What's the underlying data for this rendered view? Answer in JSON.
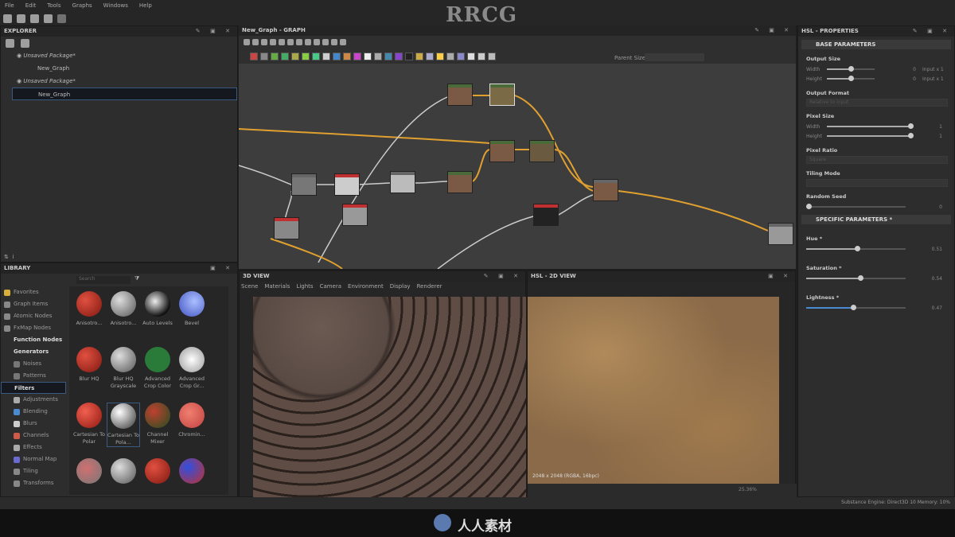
{
  "brand_watermark": "RRCG",
  "footer_logo": "人人素材",
  "menu": [
    "File",
    "Edit",
    "Tools",
    "Graphs",
    "Windows",
    "Help"
  ],
  "explorer": {
    "title": "EXPLORER",
    "items": [
      {
        "label": "Unsaved Package*",
        "child": "New_Graph"
      },
      {
        "label": "Unsaved Package*",
        "child": "New_Graph"
      }
    ]
  },
  "graph": {
    "title": "New_Graph - GRAPH",
    "parent_size_label": "Parent Size:"
  },
  "library": {
    "title": "LIBRARY",
    "search_placeholder": "Search",
    "nav": [
      {
        "label": "Favorites",
        "c": "#d6b03a"
      },
      {
        "label": "Graph Items",
        "c": "#888"
      },
      {
        "label": "Atomic Nodes",
        "c": "#888"
      },
      {
        "label": "FxMap Nodes",
        "c": "#888"
      },
      {
        "label": "Function Nodes",
        "bold": true
      },
      {
        "label": "Generators",
        "bold": true
      },
      {
        "label": "Noises",
        "sub": true,
        "c": "#777"
      },
      {
        "label": "Patterns",
        "sub": true,
        "c": "#777"
      },
      {
        "label": "Filters",
        "bold": true,
        "sel": true
      },
      {
        "label": "Adjustments",
        "sub": true,
        "c": "#aaa"
      },
      {
        "label": "Blending",
        "sub": true,
        "c": "#4a8ad0"
      },
      {
        "label": "Blurs",
        "sub": true,
        "c": "#ccc"
      },
      {
        "label": "Channels",
        "sub": true,
        "c": "#d05a4a"
      },
      {
        "label": "Effects",
        "sub": true,
        "c": "#aaa"
      },
      {
        "label": "Normal Map",
        "sub": true,
        "c": "#6a6ad0"
      },
      {
        "label": "Tiling",
        "sub": true,
        "c": "#888"
      },
      {
        "label": "Transforms",
        "sub": true,
        "c": "#888"
      }
    ],
    "items": [
      {
        "label": "Anisotro...",
        "c": "radial-gradient(circle at 35% 35%,#e05040,#801810)"
      },
      {
        "label": "Anisotro...",
        "c": "radial-gradient(circle at 35% 35%,#ddd,#555)"
      },
      {
        "label": "Auto Levels",
        "c": "radial-gradient(circle at 40% 40%,#eee,#111 70%)"
      },
      {
        "label": "Bevel",
        "c": "radial-gradient(circle at 60% 40%,#aac0ff,#4050c0)"
      },
      {
        "label": "Blur HQ",
        "c": "radial-gradient(circle at 35% 35%,#e05040,#801810)"
      },
      {
        "label": "Blur HQ Grayscale",
        "c": "radial-gradient(circle at 35% 35%,#ddd,#555)"
      },
      {
        "label": "Advanced Crop Color",
        "c": "#2a7a3a"
      },
      {
        "label": "Advanced Crop Gr...",
        "c": "radial-gradient(circle,#fff,#999)"
      },
      {
        "label": "Cartesian To Polar",
        "c": "radial-gradient(circle at 35% 35%,#f06050,#901810)"
      },
      {
        "label": "Cartesian To Pola...",
        "c": "radial-gradient(circle at 35% 35%,#fff,#333)"
      },
      {
        "label": "Channel Mixer",
        "c": "radial-gradient(circle at 35% 35%,#c04030,#205020)"
      },
      {
        "label": "Chromin...",
        "c": "radial-gradient(circle at 40% 40%,#f08070,#c04040)"
      },
      {
        "label": "",
        "c": "radial-gradient(circle at 40% 40%,#d07070,#777)"
      },
      {
        "label": "",
        "c": "radial-gradient(circle at 35% 35%,#ddd,#555)"
      },
      {
        "label": "",
        "c": "radial-gradient(circle at 35% 35%,#e05040,#801810)"
      },
      {
        "label": "",
        "c": "radial-gradient(circle at 35% 35%,#3050e0,#c03030)"
      }
    ]
  },
  "view3d": {
    "title": "3D VIEW",
    "menu": [
      "Scene",
      "Materials",
      "Lights",
      "Camera",
      "Environment",
      "Display",
      "Renderer"
    ]
  },
  "view2d": {
    "title": "HSL - 2D VIEW",
    "info": "2048 x 2048 (RGBA, 16bpc)",
    "zoom": "25.36%"
  },
  "properties": {
    "title": "HSL - PROPERTIES",
    "base": "BASE PARAMETERS",
    "specific": "SPECIFIC PARAMETERS *",
    "output_size": {
      "label": "Output Size",
      "width": "Width",
      "height": "Height",
      "wv": "0",
      "hv": "0",
      "wm": "Input x 1",
      "hm": "Input x 1"
    },
    "output_format": "Output Format",
    "format_value": "Relative to input",
    "pixel_size": {
      "label": "Pixel Size",
      "width": "Width",
      "height": "Height",
      "wv": "1",
      "hv": "1"
    },
    "pixel_ratio": "Pixel Ratio",
    "ratio_value": "Square",
    "tiling": "Tiling Mode",
    "random": "Random Seed",
    "random_value": "0",
    "params": [
      {
        "label": "Hue *",
        "value": "0.51",
        "frac": 0.51
      },
      {
        "label": "Saturation *",
        "value": "0.54",
        "frac": 0.54
      },
      {
        "label": "Lightness *",
        "value": "0.47",
        "frac": 0.47
      }
    ]
  },
  "status": "Substance Engine: Direct3D 10  Memory: 10%"
}
